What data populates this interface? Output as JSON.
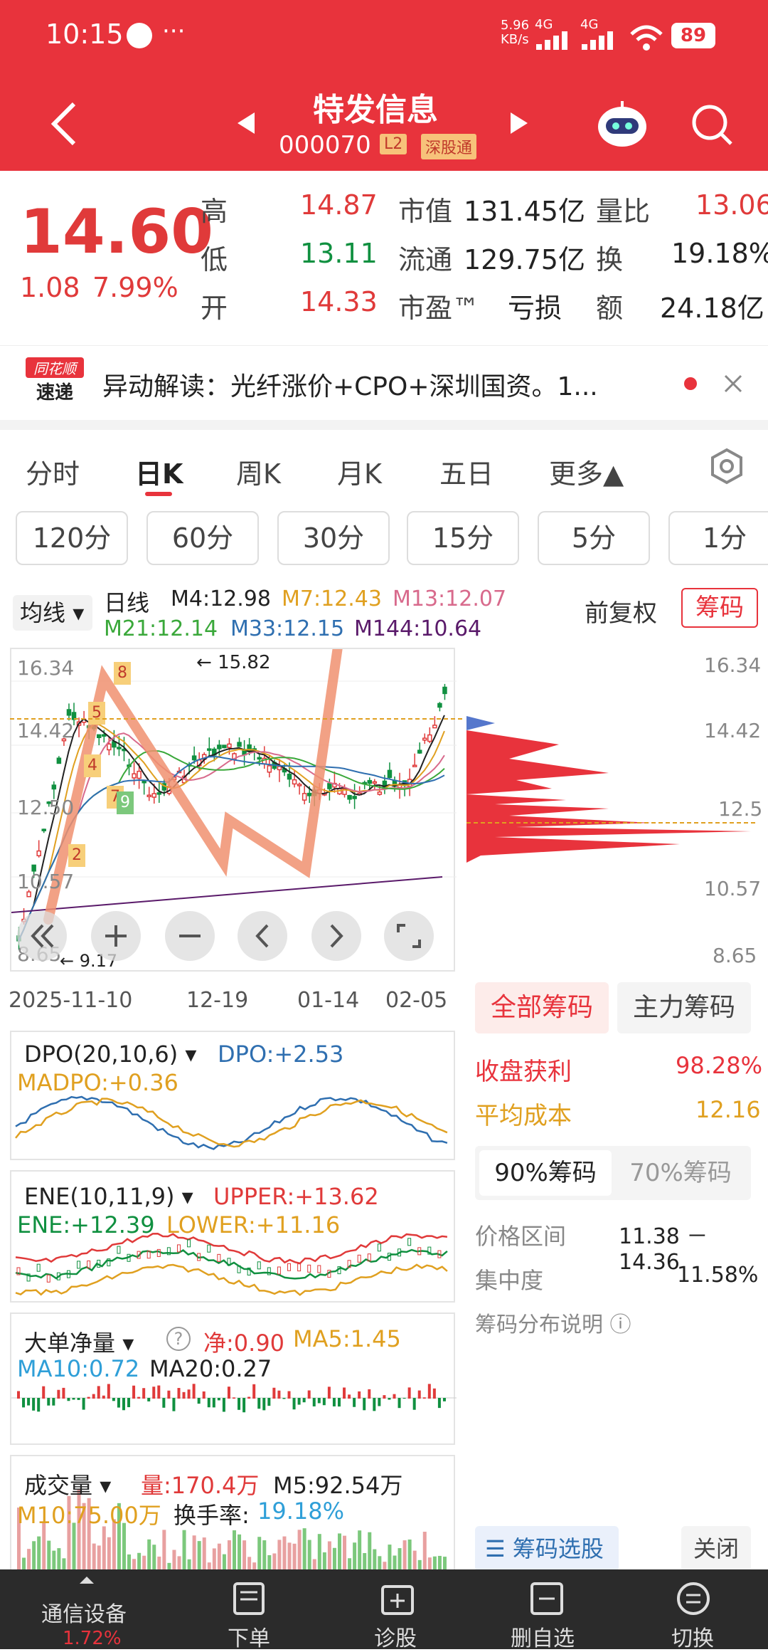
{
  "status": {
    "time": "10:15",
    "extra": "···",
    "net_speed": "5.96",
    "net_unit": "KB/s",
    "net1": "4G",
    "net2": "4G",
    "battery": "89"
  },
  "header": {
    "title": "特发信息",
    "code": "000070",
    "badge1": "L2",
    "badge2": "深股通"
  },
  "quote": {
    "price": "14.60",
    "change": "1.08",
    "change_pct": "7.99%",
    "rows": [
      {
        "l1": "高",
        "v1": "14.87",
        "l2": "市值",
        "v2": "131.45亿",
        "l3": "量比",
        "v3": "13.06"
      },
      {
        "l1": "低",
        "v1": "13.11",
        "l2": "流通",
        "v2": "129.75亿",
        "l3": "换",
        "v3": "19.18%"
      },
      {
        "l1": "开",
        "v1": "14.33",
        "l2": "市盈™",
        "v2": "亏损",
        "l3": "额",
        "v3": "24.18亿"
      }
    ]
  },
  "news": {
    "logo_top": "同花顺",
    "logo_bottom": "速递",
    "text": "异动解读：光纤涨价+CPO+深圳国资。1..."
  },
  "tabs": [
    "分时",
    "日K",
    "周K",
    "月K",
    "五日",
    "更多▲"
  ],
  "periods": [
    "120分",
    "60分",
    "30分",
    "15分",
    "5分",
    "1分"
  ],
  "kline": {
    "ma_type": "均线",
    "label": "日线",
    "m4": "M4:12.98",
    "m7": "M7:12.43",
    "m13": "M13:12.07",
    "m21": "M21:12.14",
    "m33": "M33:12.15",
    "m144": "M144:10.64",
    "fq": "前复权",
    "chouma_btn": "筹码",
    "y_ticks": [
      "16.34",
      "14.42",
      "12.50",
      "10.57",
      "8.65"
    ],
    "right_ticks": [
      "16.34",
      "14.42",
      "12.5",
      "10.57",
      "8.65"
    ],
    "x_ticks": [
      "2025-11-10",
      "12-19",
      "01-14",
      "02-05"
    ],
    "hi_note": "15.82",
    "lo_note": "9.17",
    "badges": [
      "8",
      "5",
      "4",
      "7",
      "9",
      "2"
    ]
  },
  "chips": {
    "tab1": "全部筹码",
    "tab2": "主力筹码",
    "profit_l": "收盘获利",
    "profit_v": "98.28%",
    "cost_l": "平均成本",
    "cost_v": "12.16",
    "pct1": "90%筹码",
    "pct2": "70%筹码",
    "range_l": "价格区间",
    "range_v": "11.38 － 14.36",
    "conc_l": "集中度",
    "conc_v": "11.58%",
    "desc": "筹码分布说明 ⓘ",
    "select": "筹码选股",
    "close": "关闭"
  },
  "dpo": {
    "name": "DPO(20,10,6)",
    "dpo": "DPO:+2.53",
    "madpo": "MADPO:+0.36"
  },
  "ene": {
    "name": "ENE(10,11,9)",
    "upper": "UPPER:+13.62",
    "ene": "ENE:+12.39",
    "lower": "LOWER:+11.16"
  },
  "ddj": {
    "name": "大单净量",
    "net": "净:0.90",
    "ma5": "MA5:1.45",
    "ma10": "MA10:0.72",
    "ma20": "MA20:0.27"
  },
  "vol": {
    "name": "成交量",
    "vol": "量:170.4万",
    "m5": "M5:92.54万",
    "m10": "M10:75.00万",
    "turn_l": "换手率:",
    "turn_v": "19.18%"
  },
  "nav": [
    {
      "label": "通信设备",
      "sub": "1.72%"
    },
    {
      "label": "下单"
    },
    {
      "label": "诊股"
    },
    {
      "label": "删自选"
    },
    {
      "label": "切换"
    }
  ],
  "colors": {
    "brand": "#e8333c",
    "up": "#e03a3a",
    "down": "#109040"
  }
}
